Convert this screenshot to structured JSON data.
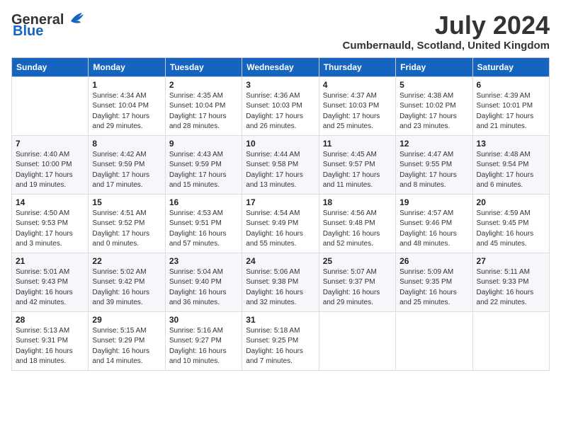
{
  "header": {
    "logo_general": "General",
    "logo_blue": "Blue",
    "month_year": "July 2024",
    "location": "Cumbernauld, Scotland, United Kingdom"
  },
  "weekdays": [
    "Sunday",
    "Monday",
    "Tuesday",
    "Wednesday",
    "Thursday",
    "Friday",
    "Saturday"
  ],
  "weeks": [
    [
      {
        "day": "",
        "sunrise": "",
        "sunset": "",
        "daylight": ""
      },
      {
        "day": "1",
        "sunrise": "Sunrise: 4:34 AM",
        "sunset": "Sunset: 10:04 PM",
        "daylight": "Daylight: 17 hours and 29 minutes."
      },
      {
        "day": "2",
        "sunrise": "Sunrise: 4:35 AM",
        "sunset": "Sunset: 10:04 PM",
        "daylight": "Daylight: 17 hours and 28 minutes."
      },
      {
        "day": "3",
        "sunrise": "Sunrise: 4:36 AM",
        "sunset": "Sunset: 10:03 PM",
        "daylight": "Daylight: 17 hours and 26 minutes."
      },
      {
        "day": "4",
        "sunrise": "Sunrise: 4:37 AM",
        "sunset": "Sunset: 10:03 PM",
        "daylight": "Daylight: 17 hours and 25 minutes."
      },
      {
        "day": "5",
        "sunrise": "Sunrise: 4:38 AM",
        "sunset": "Sunset: 10:02 PM",
        "daylight": "Daylight: 17 hours and 23 minutes."
      },
      {
        "day": "6",
        "sunrise": "Sunrise: 4:39 AM",
        "sunset": "Sunset: 10:01 PM",
        "daylight": "Daylight: 17 hours and 21 minutes."
      }
    ],
    [
      {
        "day": "7",
        "sunrise": "Sunrise: 4:40 AM",
        "sunset": "Sunset: 10:00 PM",
        "daylight": "Daylight: 17 hours and 19 minutes."
      },
      {
        "day": "8",
        "sunrise": "Sunrise: 4:42 AM",
        "sunset": "Sunset: 9:59 PM",
        "daylight": "Daylight: 17 hours and 17 minutes."
      },
      {
        "day": "9",
        "sunrise": "Sunrise: 4:43 AM",
        "sunset": "Sunset: 9:59 PM",
        "daylight": "Daylight: 17 hours and 15 minutes."
      },
      {
        "day": "10",
        "sunrise": "Sunrise: 4:44 AM",
        "sunset": "Sunset: 9:58 PM",
        "daylight": "Daylight: 17 hours and 13 minutes."
      },
      {
        "day": "11",
        "sunrise": "Sunrise: 4:45 AM",
        "sunset": "Sunset: 9:57 PM",
        "daylight": "Daylight: 17 hours and 11 minutes."
      },
      {
        "day": "12",
        "sunrise": "Sunrise: 4:47 AM",
        "sunset": "Sunset: 9:55 PM",
        "daylight": "Daylight: 17 hours and 8 minutes."
      },
      {
        "day": "13",
        "sunrise": "Sunrise: 4:48 AM",
        "sunset": "Sunset: 9:54 PM",
        "daylight": "Daylight: 17 hours and 6 minutes."
      }
    ],
    [
      {
        "day": "14",
        "sunrise": "Sunrise: 4:50 AM",
        "sunset": "Sunset: 9:53 PM",
        "daylight": "Daylight: 17 hours and 3 minutes."
      },
      {
        "day": "15",
        "sunrise": "Sunrise: 4:51 AM",
        "sunset": "Sunset: 9:52 PM",
        "daylight": "Daylight: 17 hours and 0 minutes."
      },
      {
        "day": "16",
        "sunrise": "Sunrise: 4:53 AM",
        "sunset": "Sunset: 9:51 PM",
        "daylight": "Daylight: 16 hours and 57 minutes."
      },
      {
        "day": "17",
        "sunrise": "Sunrise: 4:54 AM",
        "sunset": "Sunset: 9:49 PM",
        "daylight": "Daylight: 16 hours and 55 minutes."
      },
      {
        "day": "18",
        "sunrise": "Sunrise: 4:56 AM",
        "sunset": "Sunset: 9:48 PM",
        "daylight": "Daylight: 16 hours and 52 minutes."
      },
      {
        "day": "19",
        "sunrise": "Sunrise: 4:57 AM",
        "sunset": "Sunset: 9:46 PM",
        "daylight": "Daylight: 16 hours and 48 minutes."
      },
      {
        "day": "20",
        "sunrise": "Sunrise: 4:59 AM",
        "sunset": "Sunset: 9:45 PM",
        "daylight": "Daylight: 16 hours and 45 minutes."
      }
    ],
    [
      {
        "day": "21",
        "sunrise": "Sunrise: 5:01 AM",
        "sunset": "Sunset: 9:43 PM",
        "daylight": "Daylight: 16 hours and 42 minutes."
      },
      {
        "day": "22",
        "sunrise": "Sunrise: 5:02 AM",
        "sunset": "Sunset: 9:42 PM",
        "daylight": "Daylight: 16 hours and 39 minutes."
      },
      {
        "day": "23",
        "sunrise": "Sunrise: 5:04 AM",
        "sunset": "Sunset: 9:40 PM",
        "daylight": "Daylight: 16 hours and 36 minutes."
      },
      {
        "day": "24",
        "sunrise": "Sunrise: 5:06 AM",
        "sunset": "Sunset: 9:38 PM",
        "daylight": "Daylight: 16 hours and 32 minutes."
      },
      {
        "day": "25",
        "sunrise": "Sunrise: 5:07 AM",
        "sunset": "Sunset: 9:37 PM",
        "daylight": "Daylight: 16 hours and 29 minutes."
      },
      {
        "day": "26",
        "sunrise": "Sunrise: 5:09 AM",
        "sunset": "Sunset: 9:35 PM",
        "daylight": "Daylight: 16 hours and 25 minutes."
      },
      {
        "day": "27",
        "sunrise": "Sunrise: 5:11 AM",
        "sunset": "Sunset: 9:33 PM",
        "daylight": "Daylight: 16 hours and 22 minutes."
      }
    ],
    [
      {
        "day": "28",
        "sunrise": "Sunrise: 5:13 AM",
        "sunset": "Sunset: 9:31 PM",
        "daylight": "Daylight: 16 hours and 18 minutes."
      },
      {
        "day": "29",
        "sunrise": "Sunrise: 5:15 AM",
        "sunset": "Sunset: 9:29 PM",
        "daylight": "Daylight: 16 hours and 14 minutes."
      },
      {
        "day": "30",
        "sunrise": "Sunrise: 5:16 AM",
        "sunset": "Sunset: 9:27 PM",
        "daylight": "Daylight: 16 hours and 10 minutes."
      },
      {
        "day": "31",
        "sunrise": "Sunrise: 5:18 AM",
        "sunset": "Sunset: 9:25 PM",
        "daylight": "Daylight: 16 hours and 7 minutes."
      },
      {
        "day": "",
        "sunrise": "",
        "sunset": "",
        "daylight": ""
      },
      {
        "day": "",
        "sunrise": "",
        "sunset": "",
        "daylight": ""
      },
      {
        "day": "",
        "sunrise": "",
        "sunset": "",
        "daylight": ""
      }
    ]
  ]
}
